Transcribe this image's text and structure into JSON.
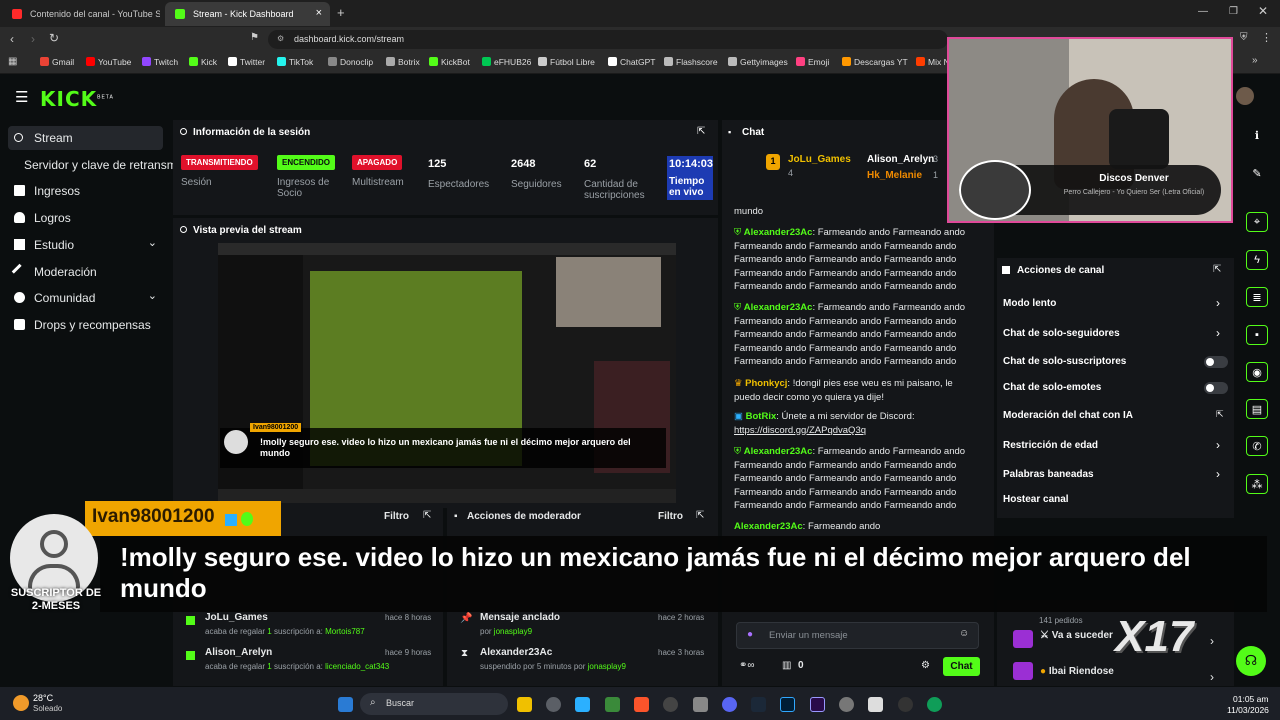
{
  "browser": {
    "tabs": [
      {
        "label": "Contenido del canal - YouTube Studi",
        "color": "#ff2a2a"
      },
      {
        "label": "Stream - Kick Dashboard",
        "color": "#53fc18"
      }
    ],
    "url": "dashboard.kick.com/stream",
    "bookmarks": [
      {
        "label": "Gmail",
        "color": "#ea4335"
      },
      {
        "label": "YouTube",
        "color": "#ff0000"
      },
      {
        "label": "Twitch",
        "color": "#9146ff"
      },
      {
        "label": "Kick",
        "color": "#53fc18"
      },
      {
        "label": "Twitter",
        "color": "#ffffff"
      },
      {
        "label": "TikTok",
        "color": "#25f4ee"
      },
      {
        "label": "Donoclip",
        "color": "#888888"
      },
      {
        "label": "Botrix",
        "color": "#aaaaaa"
      },
      {
        "label": "KickBot",
        "color": "#53fc18"
      },
      {
        "label": "eFHUB26",
        "color": "#00c853"
      },
      {
        "label": "Fútbol Libre",
        "color": "#cccccc"
      },
      {
        "label": "ChatGPT",
        "color": "#ffffff"
      },
      {
        "label": "Flashscore",
        "color": "#bbbbbb"
      },
      {
        "label": "Gettyimages",
        "color": "#bbbbbb"
      },
      {
        "label": "Emoji",
        "color": "#ff4081"
      },
      {
        "label": "Descargas YT",
        "color": "#ff9800"
      },
      {
        "label": "Mix N",
        "color": "#ff3d00"
      }
    ]
  },
  "kick": {
    "logo": "KICK",
    "beta": "BETA",
    "accent": "#53fc18"
  },
  "sidebar": {
    "items": [
      {
        "label": "Stream",
        "active": true
      },
      {
        "label": "Servidor y clave de retransmi"
      },
      {
        "label": "Ingresos"
      },
      {
        "label": "Logros"
      },
      {
        "label": "Estudio"
      },
      {
        "label": "Moderación"
      },
      {
        "label": "Comunidad"
      },
      {
        "label": "Drops y recompensas"
      }
    ]
  },
  "session": {
    "title": "Información de la sesión",
    "stats": [
      {
        "badge": "TRANSMITIENDO",
        "label": "Sesión",
        "color": "#e0112b"
      },
      {
        "badge": "ENCENDIDO",
        "label": "Ingresos de Socio",
        "color": "#53fc18"
      },
      {
        "badge": "APAGADO",
        "label": "Multistream",
        "color": "#e0112b"
      },
      {
        "value": "125",
        "label": "Espectadores"
      },
      {
        "value": "2648",
        "label": "Seguidores"
      },
      {
        "value": "62",
        "label": "Cantidad de suscripciones"
      },
      {
        "value": "10:14:03",
        "label": "Tiempo en vivo"
      }
    ]
  },
  "preview": {
    "title": "Vista previa del stream",
    "inner_user": "Ivan98001200",
    "inner_message": "!molly seguro ese. video lo hizo un mexicano jamás fue ni el décimo mejor arquero del mundo"
  },
  "lower_panels": {
    "left_filter": "Filtro",
    "mod_title": "Acciones de moderador",
    "mod_filter": "Filtro",
    "gifts": [
      {
        "user": "JoLu_Games",
        "time": "hace 8 horas",
        "text_a": "acaba de regalar",
        "count": "1",
        "text_b": "suscripción a:",
        "target": "Mortois787"
      },
      {
        "user": "Alison_Arelyn",
        "time": "hace 9 horas",
        "text_a": "acaba de regalar",
        "count": "1",
        "text_b": "suscripción a:",
        "target": "licenciado_cat343"
      }
    ],
    "mod_actions": [
      {
        "title": "Mensaje anclado",
        "time": "hace 2 horas",
        "by_label": "por",
        "by": "jonasplay9"
      },
      {
        "title": "Alexander23Ac",
        "time": "hace 3 horas",
        "by_label": "suspendido por 5 minutos por",
        "by": "jonasplay9"
      }
    ]
  },
  "chat": {
    "title": "Chat",
    "gifters": [
      {
        "name": "JoLu_Games",
        "count": "4"
      },
      {
        "name": "Alison_Arelyn",
        "count": "3"
      },
      {
        "name": "Hk_Melanie",
        "count": "1"
      }
    ],
    "top_fragment": "mundo",
    "messages": [
      {
        "user": "Alexander23Ac",
        "text": "Farmeando ando  Farmeando ando  Farmeando ando  Farmeando ando  Farmeando ando  Farmeando ando  Farmeando ando  Farmeando ando  Farmeando ando  Farmeando ando  Farmeando ando  Farmeando ando  Farmeando ando  Farmeando ando"
      },
      {
        "user": "Alexander23Ac",
        "text": "Farmeando ando  Farmeando ando  Farmeando ando  Farmeando ando  Farmeando ando  Farmeando ando  Farmeando ando  Farmeando ando  Farmeando ando  Farmeando ando  Farmeando ando  Farmeando ando  Farmeando ando  Farmeando ando"
      },
      {
        "user": "Phonkycj",
        "text": "!dongil pies ese weu es mi paisano, le puedo decir como yo quiera ya dije!"
      },
      {
        "user": "BotRix",
        "text": "Únete a mi servidor de Discord:",
        "link": "https://discord.gg/ZAPqdvaQ3q"
      },
      {
        "user": "Alexander23Ac",
        "text": "Farmeando ando  Farmeando ando  Farmeando ando  Farmeando ando  Farmeando ando  Farmeando ando  Farmeando ando  Farmeando ando  Farmeando ando  Farmeando ando  Farmeando ando  Farmeando ando  Farmeando ando  Farmeando ando"
      },
      {
        "user": "Alexander23Ac",
        "text": "Farmeando ando"
      }
    ],
    "input_placeholder": "Enviar un mensaje",
    "points": "0",
    "send_label": "Chat"
  },
  "channel_actions": {
    "title": "Acciones de canal",
    "items": [
      {
        "label": "Modo lento",
        "control": "arrow"
      },
      {
        "label": "Chat de solo-seguidores",
        "control": "arrow"
      },
      {
        "label": "Chat de solo-suscriptores",
        "control": "toggle"
      },
      {
        "label": "Chat de solo-emotes",
        "control": "toggle"
      },
      {
        "label": "Moderación del chat con IA",
        "control": "external"
      },
      {
        "label": "Restricción de edad",
        "control": "arrow"
      },
      {
        "label": "Palabras baneadas",
        "control": "arrow"
      },
      {
        "label": "Hostear canal",
        "control": "none"
      }
    ]
  },
  "requests": {
    "rows": [
      {
        "title": "",
        "count": "141 pedidos"
      },
      {
        "title": "Va a suceder",
        "count": ""
      },
      {
        "title": "Ibai Riendose",
        "count": ""
      }
    ]
  },
  "webcam": {
    "song_title": "Discos Denver",
    "song_sub": "Perro Callejero - Yo Quiero Ser (Letra Oficial)"
  },
  "overlay": {
    "user": "Ivan98001200",
    "badge_text": "SUSCRIPTOR DE 2-MESES",
    "message": "!molly seguro ese. video lo hizo un mexicano jamás fue ni el décimo mejor arquero del mundo",
    "watermark": "X17"
  },
  "taskbar": {
    "temp": "28°C",
    "weather": "Soleado",
    "search": "Buscar",
    "time": "01:05 am",
    "date": "11/03/2026"
  }
}
